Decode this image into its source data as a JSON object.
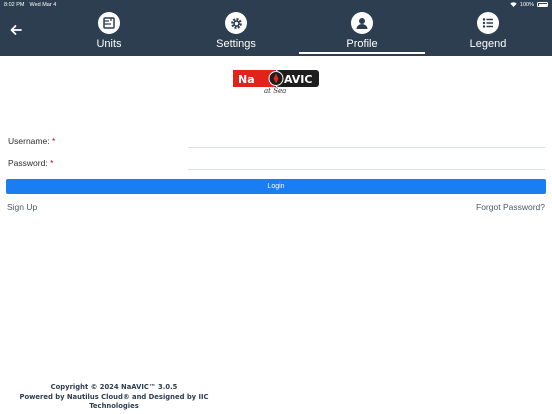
{
  "status_bar": {
    "time": "8:02 PM",
    "date": "Wed Mar 4",
    "battery": "100%"
  },
  "nav": {
    "back_icon": "arrow-left-icon",
    "tabs": [
      {
        "label": "Units",
        "icon": "ruler-icon"
      },
      {
        "label": "Settings",
        "icon": "gear-icon"
      },
      {
        "label": "Profile",
        "icon": "user-icon",
        "selected": true
      },
      {
        "label": "Legend",
        "icon": "list-icon"
      }
    ]
  },
  "logo": {
    "text": "NaAVIC",
    "tagline": "at Sea"
  },
  "form": {
    "username_label": "Username:",
    "password_label": "Password:",
    "required_mark": "*",
    "username_value": "",
    "password_value": "",
    "login_label": "Login"
  },
  "links": {
    "sign_up": "Sign Up",
    "forgot_password": "Forgot Password?"
  },
  "footer": {
    "line1": "Copyright © 2024 NaAVIC™ 3.0.5",
    "line2": "Powered by Nautilus Cloud® and Designed by IIC",
    "line3": "Technologies"
  },
  "colors": {
    "nav_bg": "#2d3e50",
    "accent": "#1a7ef2",
    "required": "#d0021b",
    "logo_red": "#e2231a"
  }
}
